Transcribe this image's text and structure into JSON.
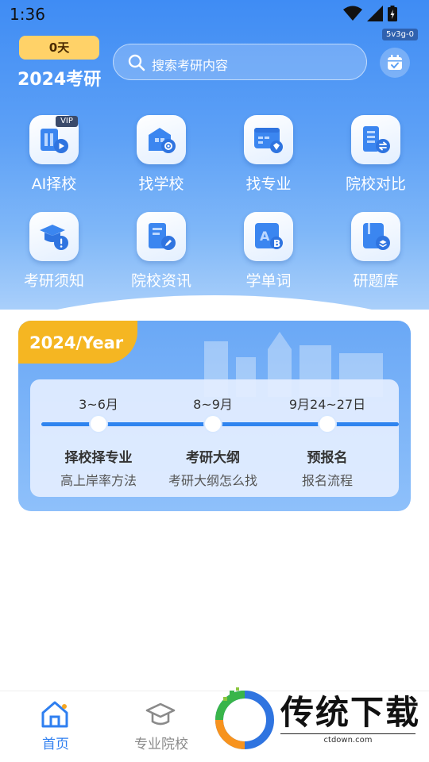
{
  "status": {
    "time": "1:36",
    "build_tag": "5v3g-0"
  },
  "header": {
    "days_badge": "0天",
    "year_title": "2024考研",
    "search_placeholder": "搜索考研内容"
  },
  "menu": {
    "items": [
      {
        "label": "AI择校",
        "icon": "ai-school-icon",
        "tag": "VIP"
      },
      {
        "label": "找学校",
        "icon": "find-school-icon"
      },
      {
        "label": "找专业",
        "icon": "find-major-icon"
      },
      {
        "label": "院校对比",
        "icon": "compare-icon"
      },
      {
        "label": "考研须知",
        "icon": "notice-icon"
      },
      {
        "label": "院校资讯",
        "icon": "news-icon"
      },
      {
        "label": "学单词",
        "icon": "vocabulary-icon"
      },
      {
        "label": "研题库",
        "icon": "question-bank-icon"
      }
    ]
  },
  "timeline": {
    "title": "2024/Year",
    "steps": [
      {
        "date": "3~6月",
        "title": "择校择专业",
        "subtitle": "高上岸率方法"
      },
      {
        "date": "8~9月",
        "title": "考研大纲",
        "subtitle": "考研大纲怎么找"
      },
      {
        "date": "9月24~27日",
        "title": "预报名",
        "subtitle": "报名流程"
      }
    ]
  },
  "bottom_nav": {
    "items": [
      {
        "label": "首页",
        "active": true
      },
      {
        "label": "专业院校",
        "active": false
      }
    ]
  },
  "watermark": {
    "text": "传统下载",
    "url": "ctdown.com"
  },
  "colors": {
    "primary": "#3f8cf4",
    "accent": "#f5b622",
    "active_tab": "#2f7ff0",
    "inactive_tab": "#8a8a8a"
  }
}
